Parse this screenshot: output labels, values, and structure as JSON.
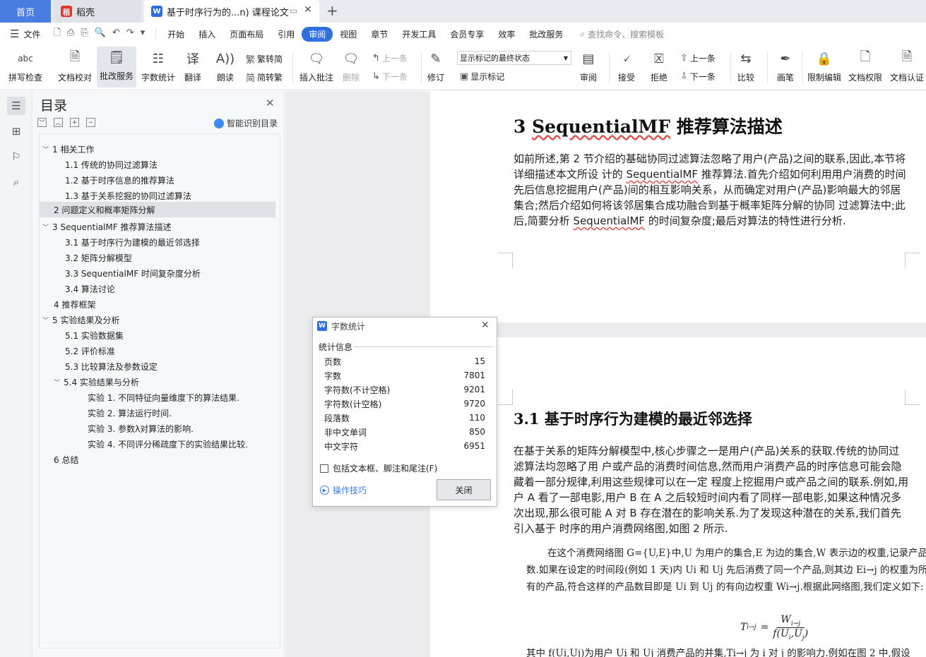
{
  "tabs": {
    "home": "首页",
    "daoke": "稻壳",
    "doc": "基于时序行为的...n) 课程论文"
  },
  "menu": {
    "file": "文件",
    "items": [
      "开始",
      "插入",
      "页面布局",
      "引用",
      "审阅",
      "视图",
      "章节",
      "开发工具",
      "会员专享",
      "效率",
      "批改服务"
    ],
    "active": "审阅",
    "search_placeholder": "查找命令、搜索模板"
  },
  "ribbon": {
    "spell": "拼写检查",
    "proof": "文档校对",
    "review_service": "批改服务",
    "word_count": "字数统计",
    "translate": "翻译",
    "read_aloud": "朗读",
    "to_traditional": "繁转简",
    "to_simplified": "简转繁",
    "insert_comment": "插入批注",
    "delete": "删除",
    "prev": "上一条",
    "next": "下一条",
    "revise": "修订",
    "markup_state": "显示标记的最终状态",
    "show_markup": "显示标记",
    "review": "审阅",
    "accept": "接受",
    "reject": "拒绝",
    "prev2": "上一条",
    "next2": "下一条",
    "compare": "比较",
    "pen": "画笔",
    "restrict": "限制编辑",
    "doc_perm": "文档权限",
    "doc_cert": "文档认证"
  },
  "toc": {
    "title": "目录",
    "smart": "智能识别目录",
    "items": [
      {
        "text": "1 相关工作",
        "caret": "﹀"
      },
      {
        "text": "1.1  传统的协同过滤算法",
        "caret": ""
      },
      {
        "text": "1.2  基于时序信息的推荐算法",
        "caret": ""
      },
      {
        "text": "1.3  基于关系挖掘的协同过滤算法",
        "caret": ""
      },
      {
        "text": "2  问题定义和概率矩阵分解",
        "caret": ""
      },
      {
        "text": "3 SequentialMF  推荐算法描述",
        "caret": "﹀"
      },
      {
        "text": "3.1  基于时序行为建模的最近邻选择",
        "caret": ""
      },
      {
        "text": "3.2  矩阵分解模型",
        "caret": ""
      },
      {
        "text": "3.3 SequentialMF 时间复杂度分析",
        "caret": ""
      },
      {
        "text": "3.4  算法讨论",
        "caret": ""
      },
      {
        "text": "4  推荐框架",
        "caret": ""
      },
      {
        "text": "5  实验结果及分析",
        "caret": "﹀"
      },
      {
        "text": "5.1  实验数据集",
        "caret": ""
      },
      {
        "text": "5.2  评价标准",
        "caret": ""
      },
      {
        "text": "5.3  比较算法及参数设定",
        "caret": ""
      },
      {
        "text": "5.4  实验结果与分析",
        "caret": "﹀"
      },
      {
        "text": "实验  1.  不同特征向量维度下的算法结果.",
        "caret": ""
      },
      {
        "text": "实验  2.  算法运行时间.",
        "caret": ""
      },
      {
        "text": "实验  3.  参数λ对算法的影响.",
        "caret": ""
      },
      {
        "text": "实验  4.  不同评分稀疏度下的实验结果比较.",
        "caret": ""
      },
      {
        "text": "6 总结",
        "caret": ""
      }
    ]
  },
  "doc": {
    "h1_num": "3",
    "h1_sq": "SequentialMF",
    "h1_text": "推荐算法描述",
    "p1a": "如前所述,第  2  节介绍的基础协同过滤算法忽略了用户(产品)之间的联系,因此,本节将详细描述本文所设  计的  ",
    "p1_sq": "SequentialMF",
    "p1b": "  推荐算法.首先介绍如何利用用户消费的时间先后信息挖掘用户(产品)间的相互影响关系，从而确定对用户(产品)影响最大的邻居集合;然后介绍如何将该邻居集合成功融合到基于概率矩阵分解的协同  过滤算法中;此后,简要分析  ",
    "p1_sq2": "SequentialMF",
    "p1c": "  的时间复杂度;最后对算法的特性进行分析.",
    "h2": "3.1  基于时序行为建模的最近邻选择",
    "p2": "在基于关系的矩阵分解模型中,核心步骤之一是用户(产品)关系的获取.传统的协同过滤算法均忽略了用  户或产品的消费时间信息,然而用户消费产品的时序信息可能会隐藏着一部分规律,利用这些规律可以在一定  程度上挖掘用户或产品之间的联系.例如,用户 A 看了一部电影,用户 B 在 A 之后较短时间内看了同样一部电影,如果这种情况多次出现,那么很可能 A 对 B 存在潜在的影响关系.为了发现这种潜在的关系,我们首先引入基于  时序的用户消费网络图,如图  2  所示.",
    "p3": "在这个消费网络图 G={U,E}中,U 为用户的集合,E 为边的集合,W 表示边的权重,记录产品数.如果在设定的时间段(例如 1 天)内 Ui 和 Uj 先后消费了同一个产品,则其边 Ei→j 的权重为所有的产品,符合这样的产品数目即是 Ui 到 Uj 的有向边权重 Wi→j.根据此网络图,我们定义如下:",
    "formula_lhs": "T",
    "formula_num": "W",
    "formula_den": "f(U",
    "p4": "其中 f(Ui,Uj)为用户 Ui 和 Uj 消费产品的并集,Ti→j 为 i 对 j 的影响力.例如在图 2 中,假设"
  },
  "dialog": {
    "title": "字数统计",
    "section": "统计信息",
    "stats": [
      {
        "label": "页数",
        "value": "15"
      },
      {
        "label": "字数",
        "value": "7801"
      },
      {
        "label": "字符数(不计空格)",
        "value": "9201"
      },
      {
        "label": "字符数(计空格)",
        "value": "9720"
      },
      {
        "label": "段落数",
        "value": "110"
      },
      {
        "label": "非中文单词",
        "value": "850"
      },
      {
        "label": "中文字符",
        "value": "6951"
      }
    ],
    "include": "包括文本框、脚注和尾注(F)",
    "tips": "操作技巧",
    "close": "关闭"
  },
  "colors": {
    "accent": "#2f6fe0",
    "home_tab": "#4a7de0"
  }
}
